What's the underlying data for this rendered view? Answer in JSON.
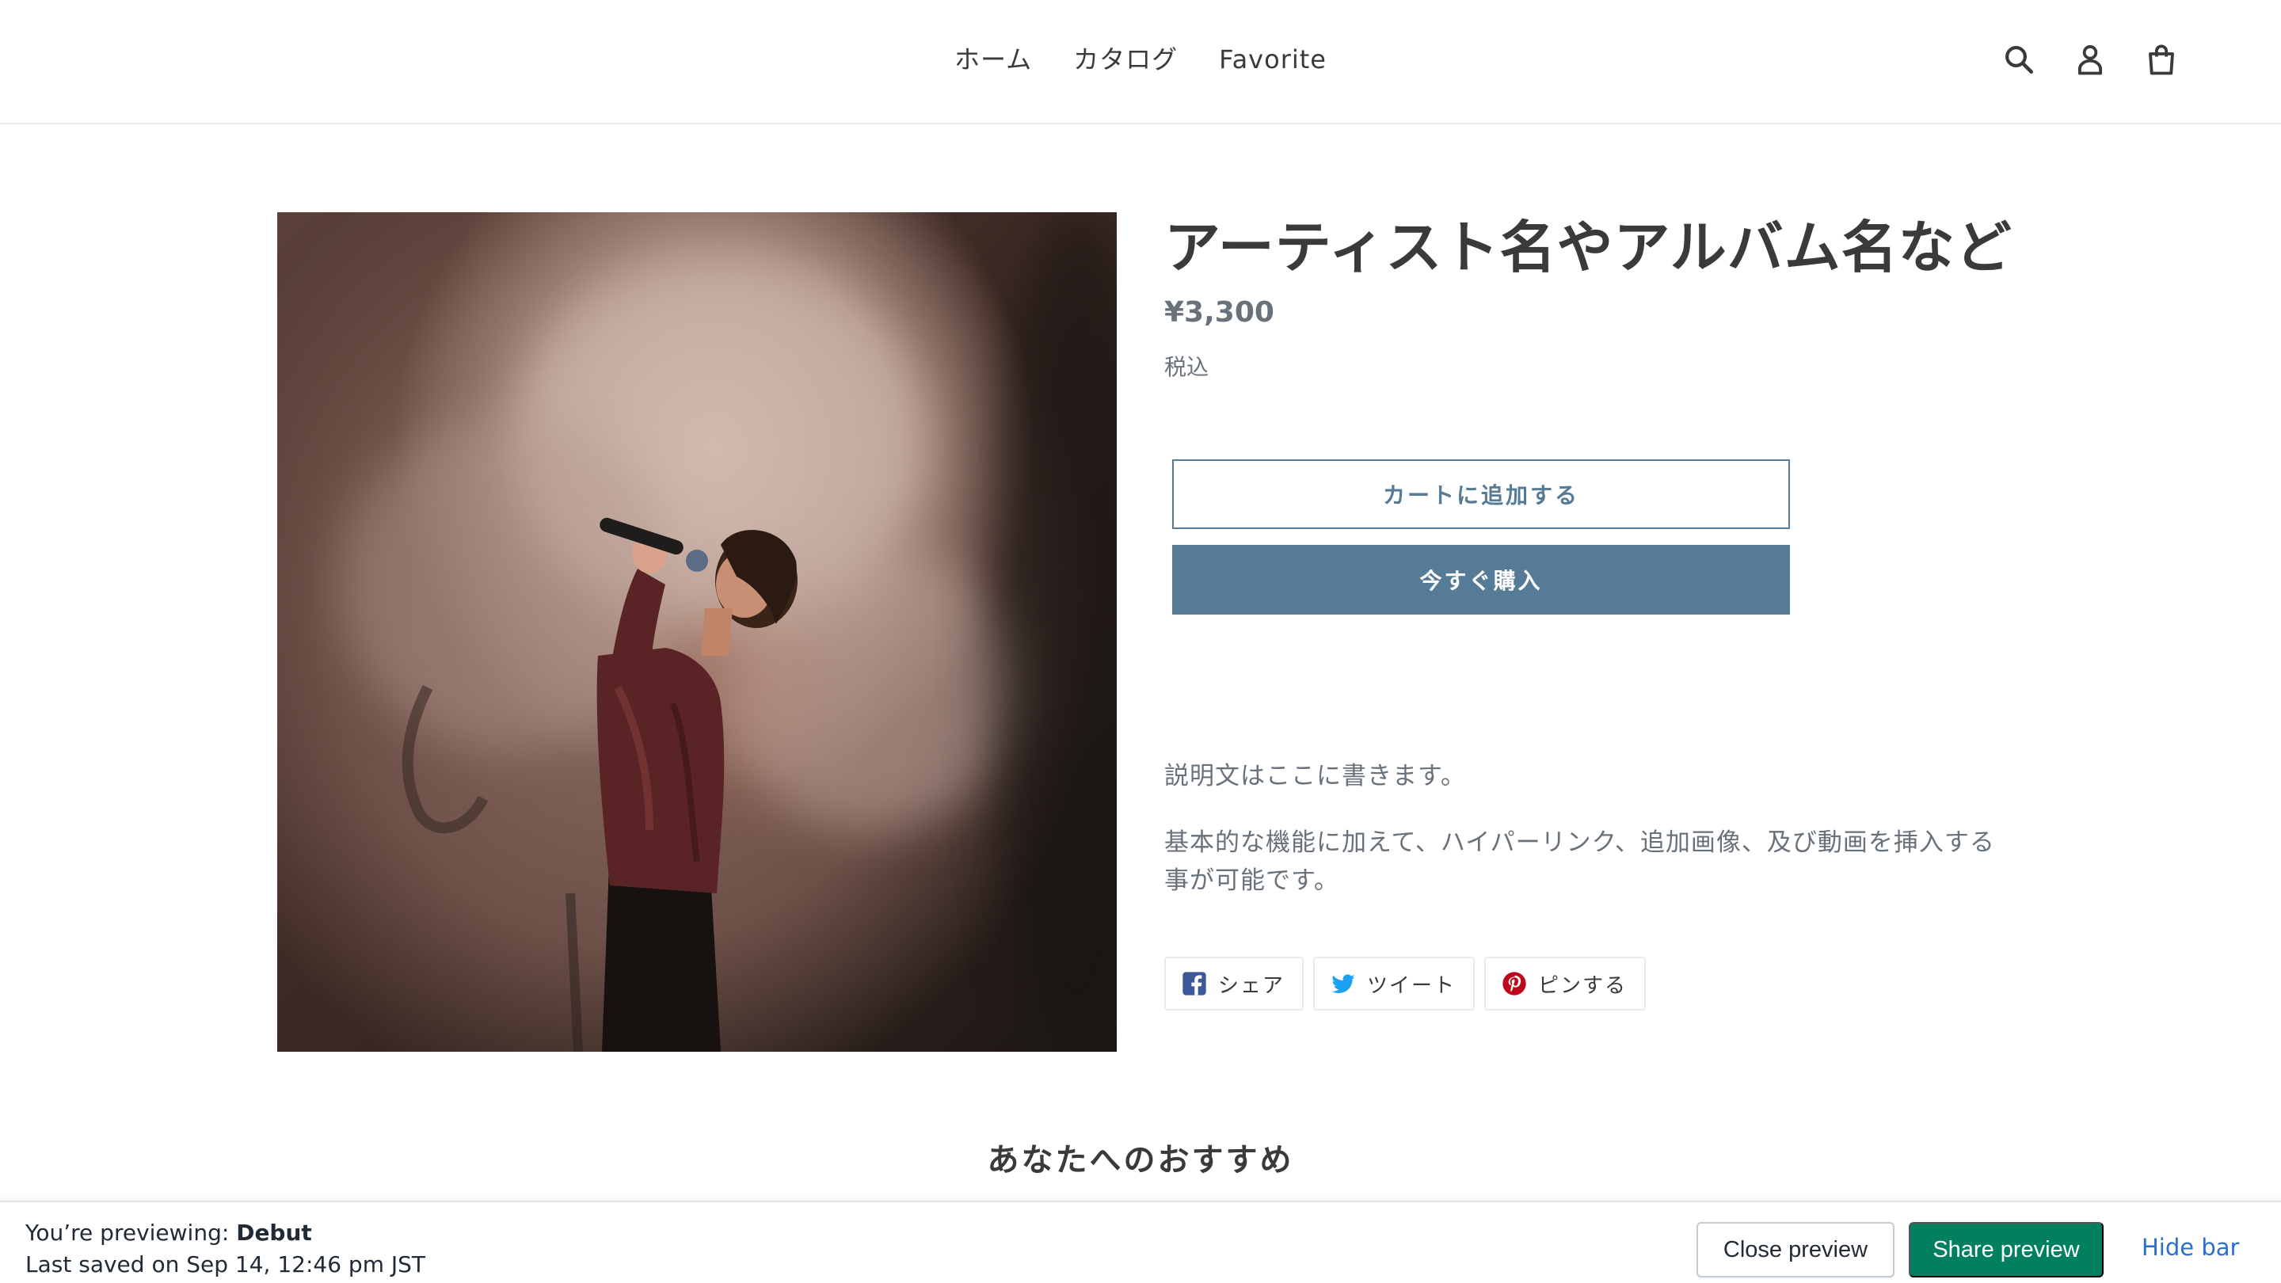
{
  "nav": {
    "items": [
      "ホーム",
      "カタログ",
      "Favorite"
    ]
  },
  "header_icons": [
    "search-icon",
    "account-icon",
    "cart-icon"
  ],
  "product": {
    "title": "アーティスト名やアルバム名など",
    "price": "¥3,300",
    "tax_note": "税込",
    "add_to_cart": "カートに追加する",
    "buy_now": "今すぐ購入",
    "description_1": "説明文はここに書きます。",
    "description_2": "基本的な機能に加えて、ハイパーリンク、追加画像、及び動画を挿入する事が可能です。",
    "share": [
      {
        "label": "シェア",
        "icon": "facebook-icon",
        "color": "#3b5998"
      },
      {
        "label": "ツイート",
        "icon": "twitter-icon",
        "color": "#1da1f2"
      },
      {
        "label": "ピンする",
        "icon": "pinterest-icon",
        "color": "#bd081c"
      }
    ]
  },
  "recommend_heading": "あなたへのおすすめ",
  "preview_bar": {
    "previewing_prefix": "You’re previewing: ",
    "theme_name": "Debut",
    "last_saved": "Last saved on Sep 14, 12:46 pm JST",
    "close_preview": "Close preview",
    "share_preview": "Share preview",
    "hide_bar": "Hide bar"
  },
  "colors": {
    "accent": "#557b97",
    "share_green": "#008060",
    "link_blue": "#2c6ecb"
  }
}
